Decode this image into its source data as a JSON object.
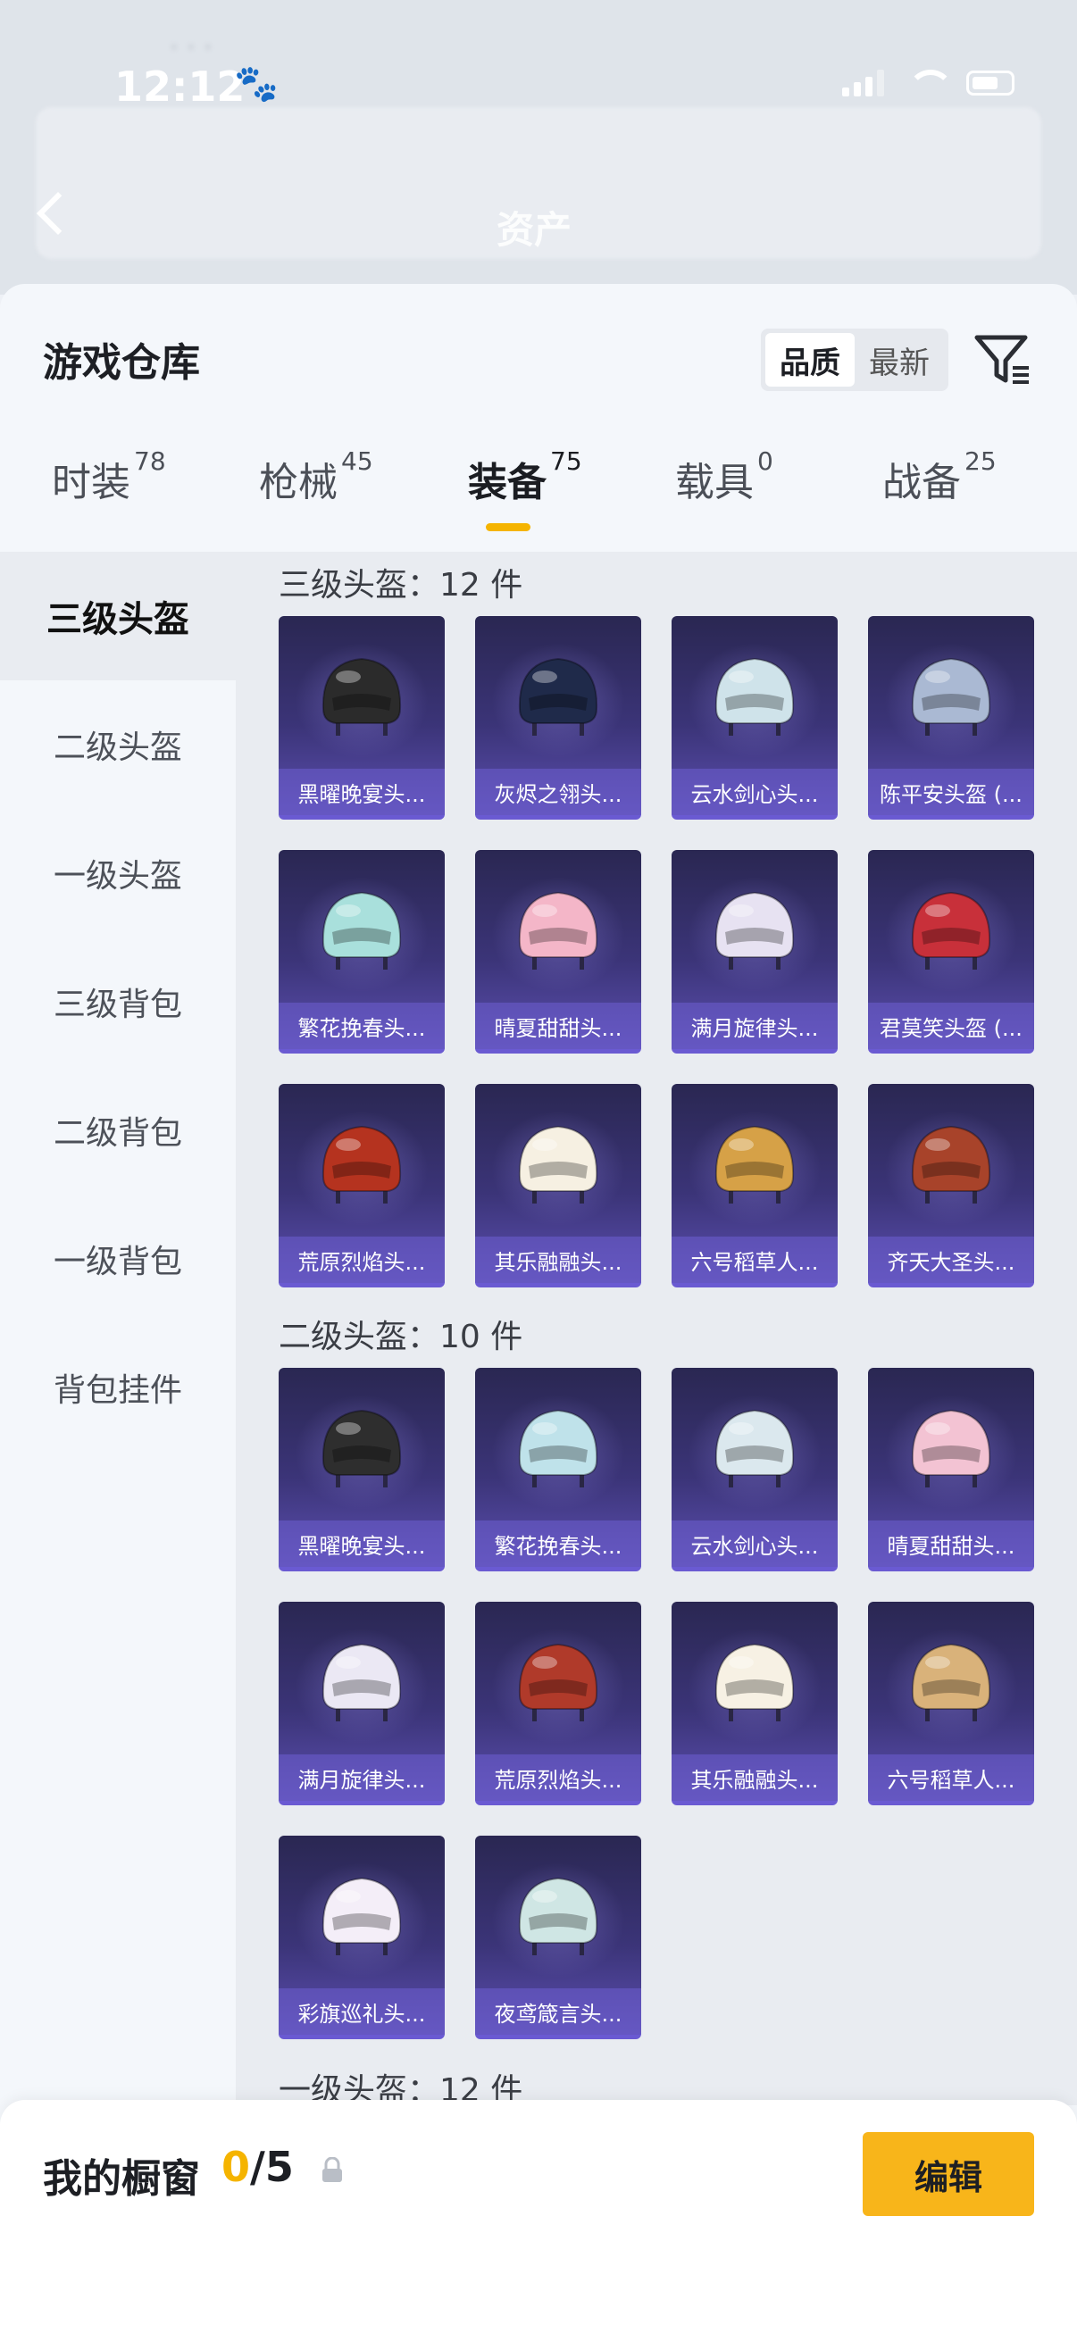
{
  "status_bar": {
    "time": "12:12",
    "paw": "🐾"
  },
  "header": {
    "title": "资产"
  },
  "sheet": {
    "title": "游戏仓库",
    "sort": {
      "options": [
        "品质",
        "最新"
      ],
      "active": "品质"
    }
  },
  "tabs": [
    {
      "label": "时装",
      "count": "78"
    },
    {
      "label": "枪械",
      "count": "45"
    },
    {
      "label": "装备",
      "count": "75",
      "active": true
    },
    {
      "label": "载具",
      "count": "0"
    },
    {
      "label": "战备",
      "count": "25"
    }
  ],
  "sidebar": {
    "items": [
      "三级头盔",
      "二级头盔",
      "一级头盔",
      "三级背包",
      "二级背包",
      "一级背包",
      "背包挂件"
    ],
    "active": "三级头盔"
  },
  "sections": [
    {
      "title": "三级头盔：12 件",
      "items": [
        {
          "name": "黑曜晚宴头...",
          "color": "#2b2b2b"
        },
        {
          "name": "灰烬之翎头...",
          "color": "#1f2a4a"
        },
        {
          "name": "云水剑心头...",
          "color": "#cfe3ea"
        },
        {
          "name": "陈平安头盔 (...",
          "color": "#aab9d3"
        },
        {
          "name": "繁花挽春头...",
          "color": "#a9e0dc"
        },
        {
          "name": "晴夏甜甜头...",
          "color": "#f4b6c8"
        },
        {
          "name": "满月旋律头...",
          "color": "#e7e2f2"
        },
        {
          "name": "君莫笑头盔 (...",
          "color": "#c8303a"
        },
        {
          "name": "荒原烈焰头...",
          "color": "#b5331f"
        },
        {
          "name": "其乐融融头...",
          "color": "#f6f0e2"
        },
        {
          "name": "六号稻草人...",
          "color": "#d6a147"
        },
        {
          "name": "齐天大圣头...",
          "color": "#a8432a"
        }
      ]
    },
    {
      "title": "二级头盔：10 件",
      "items": [
        {
          "name": "黑曜晚宴头...",
          "color": "#2e2e2e"
        },
        {
          "name": "繁花挽春头...",
          "color": "#bfe2ea"
        },
        {
          "name": "云水剑心头...",
          "color": "#dbe8ee"
        },
        {
          "name": "晴夏甜甜头...",
          "color": "#f3c3d3"
        },
        {
          "name": "满月旋律头...",
          "color": "#ebe8f4"
        },
        {
          "name": "荒原烈焰头...",
          "color": "#b03a2a"
        },
        {
          "name": "其乐融融头...",
          "color": "#f7f1e4"
        },
        {
          "name": "六号稻草人...",
          "color": "#d9b27a"
        },
        {
          "name": "彩旗巡礼头...",
          "color": "#f4eef8"
        },
        {
          "name": "夜鸢箴言头...",
          "color": "#cfe6e4"
        }
      ]
    },
    {
      "title": "一级头盔：12 件",
      "items": []
    }
  ],
  "bottom": {
    "title": "我的橱窗",
    "current": "0",
    "total": "/5",
    "edit_label": "编辑"
  },
  "colors": {
    "accent": "#f8b51a",
    "card_top": "#2a2752",
    "card_bottom": "#5c4fb0"
  }
}
